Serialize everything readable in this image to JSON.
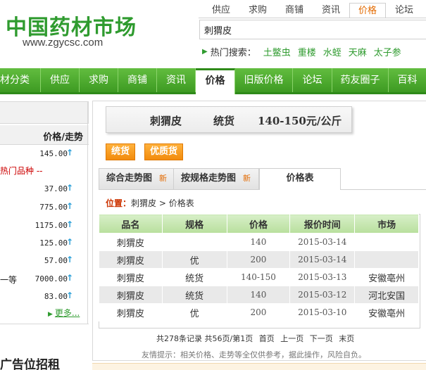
{
  "header": {
    "logo_text": "中国药材市场",
    "logo_url": "www.zgycsc.com",
    "top_tabs": [
      {
        "label": "供应",
        "active": false
      },
      {
        "label": "求购",
        "active": false
      },
      {
        "label": "商铺",
        "active": false
      },
      {
        "label": "资讯",
        "active": false
      },
      {
        "label": "价格",
        "active": true
      },
      {
        "label": "论坛",
        "active": false
      }
    ],
    "search_value": "刺猬皮",
    "hot_label": "热门搜索：",
    "hot_keywords": [
      "土鳖虫",
      "重楼",
      "水蛭",
      "天麻",
      "太子参"
    ]
  },
  "nav": {
    "items": [
      {
        "label": "材分类",
        "active": false
      },
      {
        "label": "供应",
        "active": false
      },
      {
        "label": "求购",
        "active": false
      },
      {
        "label": "商铺",
        "active": false
      },
      {
        "label": "资讯",
        "active": false
      },
      {
        "label": "价格",
        "active": true
      },
      {
        "label": "旧版价格",
        "active": false
      },
      {
        "label": "论坛",
        "active": false
      },
      {
        "label": "药友圈子",
        "active": false
      },
      {
        "label": "百科",
        "active": false
      }
    ]
  },
  "sidebar": {
    "header": "价格/走势",
    "hot_text": "热门品种 --",
    "rows": [
      {
        "name": "",
        "price": "145.00"
      },
      {
        "name": "",
        "price": "37.00"
      },
      {
        "name": "",
        "price": "775.00"
      },
      {
        "name": "",
        "price": "1175.00"
      },
      {
        "name": "",
        "price": "125.00"
      },
      {
        "name": "",
        "price": "57.00"
      },
      {
        "name": "一等",
        "price": "7000.00"
      },
      {
        "name": "",
        "price": "83.00"
      }
    ],
    "more": "更多...",
    "ad": "广告位招租"
  },
  "main": {
    "title": {
      "name": "刺猬皮",
      "grade": "统货",
      "price": "140-150元/公斤"
    },
    "grade_buttons": [
      "统货",
      "优质货"
    ],
    "tabs": [
      {
        "label": "综合走势图",
        "badge": "新"
      },
      {
        "label": "按规格走势图",
        "badge": "新"
      },
      {
        "label": "价格表",
        "badge": ""
      }
    ],
    "breadcrumb": {
      "label": "位置：",
      "path": "刺猬皮 > 价格表"
    },
    "table": {
      "headers": [
        "品名",
        "规格",
        "价格",
        "报价时间",
        "市场"
      ],
      "rows": [
        [
          "刺猬皮",
          "",
          "140",
          "2015-03-14",
          ""
        ],
        [
          "刺猬皮",
          "优",
          "200",
          "2015-03-14",
          ""
        ],
        [
          "刺猬皮",
          "统货",
          "140-150",
          "2015-03-13",
          "安徽亳州"
        ],
        [
          "刺猬皮",
          "统货",
          "140",
          "2015-03-12",
          "河北安国"
        ],
        [
          "刺猬皮",
          "优",
          "200",
          "2015-03-10",
          "安徽亳州"
        ]
      ]
    },
    "pager": {
      "summary": "共278条记录 共56页/第1页",
      "first": "首页",
      "prev": "上一页",
      "next": "下一页",
      "last": "末页"
    },
    "hint": "友情提示：相关价格、走势等全仅供参考，据此操作，风险自负。"
  }
}
